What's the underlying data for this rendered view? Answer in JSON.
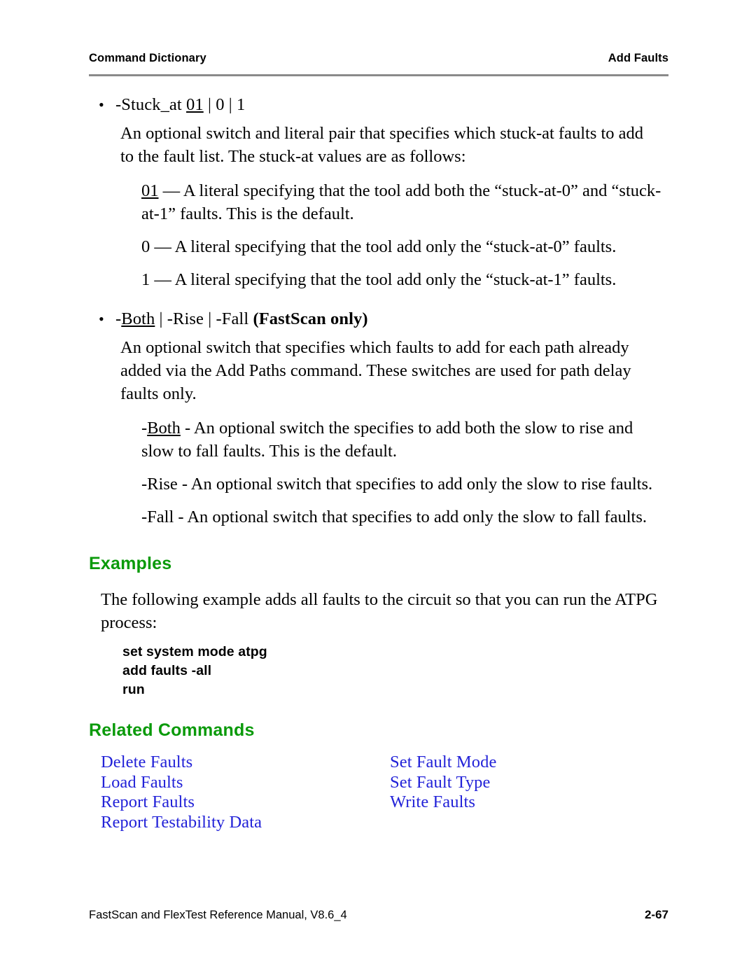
{
  "header": {
    "left": "Command Dictionary",
    "right": "Add Faults"
  },
  "bullets": [
    {
      "id": "stuck-at",
      "marker": "•",
      "switch_prefix": "-Stuck_at ",
      "default_literal": "01",
      "alternatives": " | 0 | 1",
      "description": "An optional switch and literal pair that specifies which stuck-at faults to add to the fault list. The stuck-at values are as follows:",
      "literals": [
        {
          "name": "01",
          "underlined": true,
          "text": " — A literal specifying that the tool add both the “stuck-at-0” and “stuck-at-1” faults. This is the default."
        },
        {
          "name": "0",
          "underlined": false,
          "text": " — A literal specifying that the tool add only the “stuck-at-0” faults."
        },
        {
          "name": "1",
          "underlined": false,
          "text": " — A literal specifying that the tool add only the “stuck-at-1” faults."
        }
      ]
    },
    {
      "id": "both-rise-fall",
      "marker": "•",
      "switch_prefix": "-",
      "default_literal": "Both",
      "alternatives": " | -Rise | -Fall ",
      "qualifier": "(FastScan only)",
      "description": "An optional switch that specifies which faults to add for each path already added via the Add Paths command. These switches are used for path delay faults only.",
      "literals": [
        {
          "name": "Both",
          "underlined": true,
          "prefix": "-",
          "text": " - An optional switch the specifies to add both the slow to rise and slow to fall faults. This is the default."
        },
        {
          "name": "Rise",
          "underlined": false,
          "prefix": "-",
          "text": " - An optional switch that specifies to add only the slow to rise faults."
        },
        {
          "name": "Fall",
          "underlined": false,
          "prefix": "-",
          "text": " - An optional switch that specifies to add only the slow to fall faults."
        }
      ]
    }
  ],
  "examples": {
    "heading": "Examples",
    "intro": "The following example adds all faults to the circuit so that you can run the ATPG process:",
    "code_lines": [
      "set system mode atpg",
      "add faults -all",
      "run"
    ]
  },
  "related_commands": {
    "heading": "Related Commands",
    "left_column": [
      "Delete Faults",
      "Load Faults",
      "Report Faults",
      "Report Testability Data"
    ],
    "right_column": [
      "Set Fault Mode",
      "Set Fault Type",
      "Write Faults"
    ]
  },
  "footer": {
    "left": "FastScan and FlexTest Reference Manual, V8.6_4",
    "right": "2-67"
  },
  "colors": {
    "heading_green": "#0a9a0a",
    "link_blue": "#2222d8",
    "rule_gray": "#8a8a8a"
  }
}
